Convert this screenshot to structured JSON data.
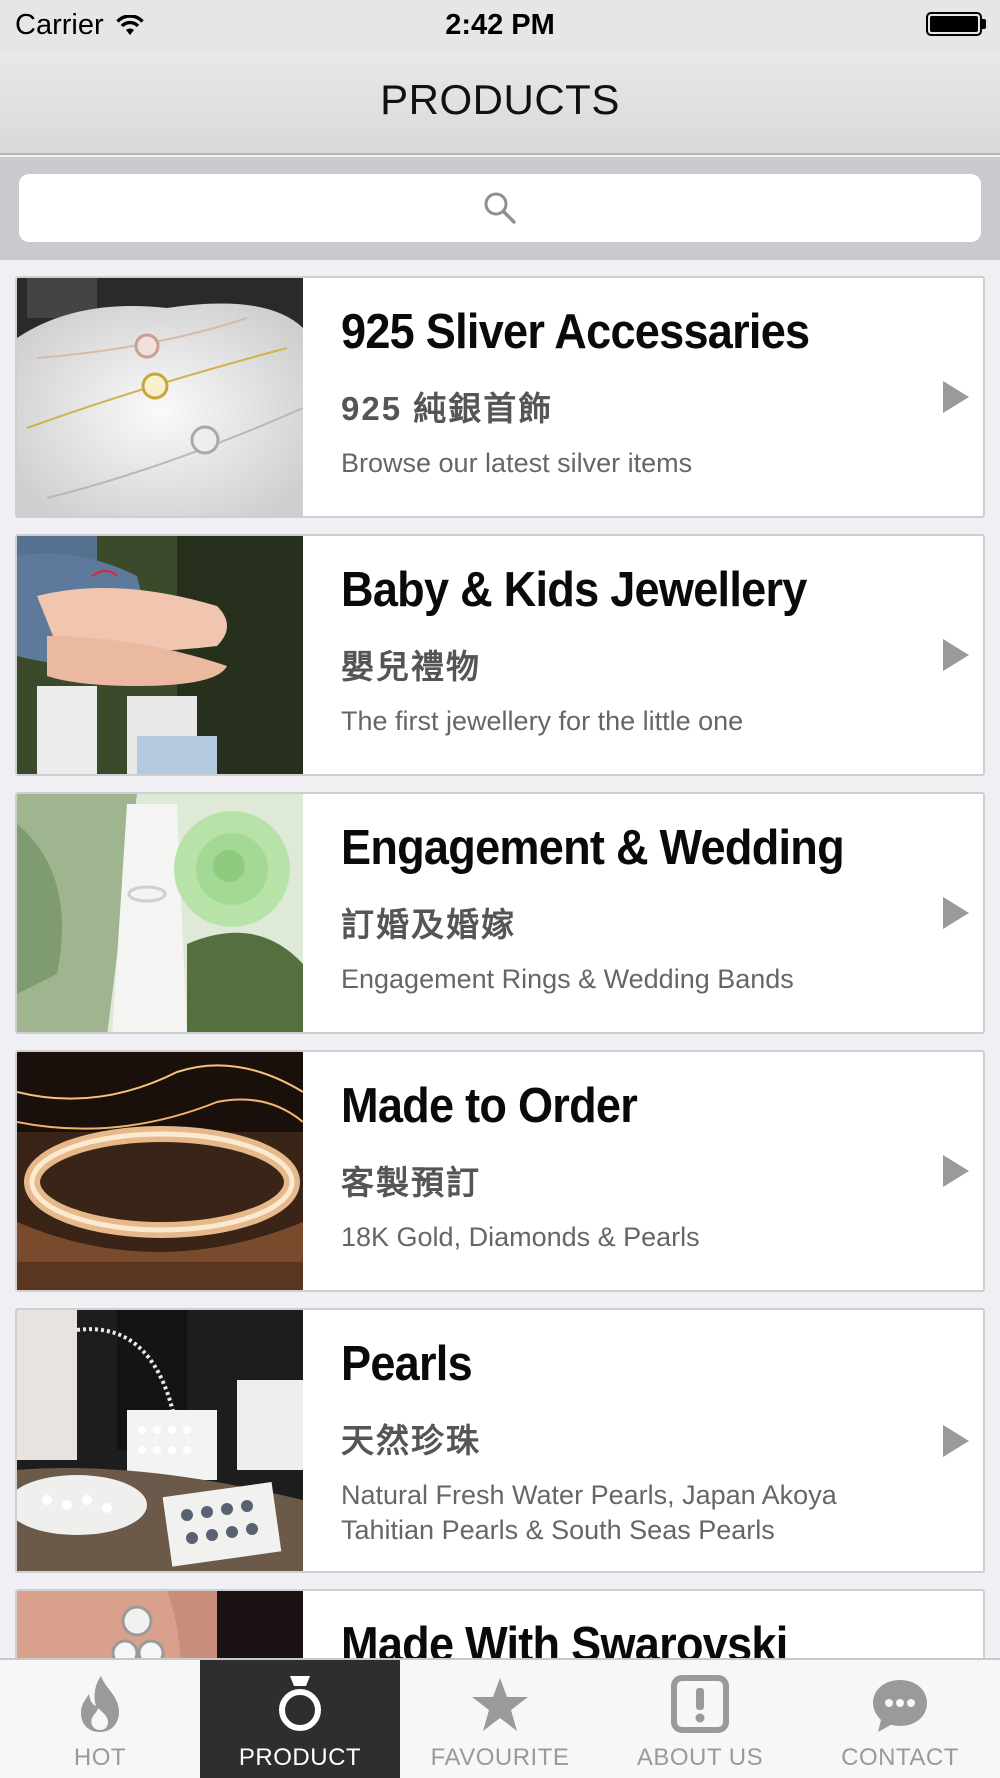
{
  "status_bar": {
    "carrier": "Carrier",
    "time": "2:42 PM"
  },
  "nav": {
    "title": "PRODUCTS"
  },
  "search": {
    "placeholder": ""
  },
  "categories": [
    {
      "title": "925 Sliver Accessaries",
      "subtitle": "925 純銀首飾",
      "description": "Browse our latest silver items",
      "image": "silver-bracelets-photo"
    },
    {
      "title": "Baby & Kids Jewellery",
      "subtitle": "嬰兒禮物",
      "description": "The first jewellery for the little one",
      "image": "child-bracelet-photo"
    },
    {
      "title": "Engagement & Wedding",
      "subtitle": "訂婚及婚嫁",
      "description": "Engagement Rings & Wedding Bands",
      "image": "ring-and-rose-photo"
    },
    {
      "title": "Made to Order",
      "subtitle": "客製預訂",
      "description": "18K Gold, Diamonds & Pearls",
      "image": "gold-bangle-photo"
    },
    {
      "title": "Pearls",
      "subtitle": "天然珍珠",
      "description": "Natural Fresh Water Pearls, Japan Akoya\nTahitian Pearls & South Seas Pearls",
      "image": "pearl-display-photo"
    },
    {
      "title": "Made With Swarovski",
      "subtitle": "",
      "description": "",
      "image": "crystal-earring-photo"
    }
  ],
  "tabs": [
    {
      "label": "HOT",
      "icon": "flame-icon",
      "active": false
    },
    {
      "label": "PRODUCT",
      "icon": "ring-icon",
      "active": true
    },
    {
      "label": "FAVOURITE",
      "icon": "star-icon",
      "active": false
    },
    {
      "label": "ABOUT US",
      "icon": "exclamation-icon",
      "active": false
    },
    {
      "label": "CONTACT",
      "icon": "chat-bubble-icon",
      "active": false
    }
  ],
  "colors": {
    "tab_active_bg": "#2e2e2e",
    "tab_inactive": "#9a9a9a",
    "search_bar_bg": "#c9c9ce"
  }
}
